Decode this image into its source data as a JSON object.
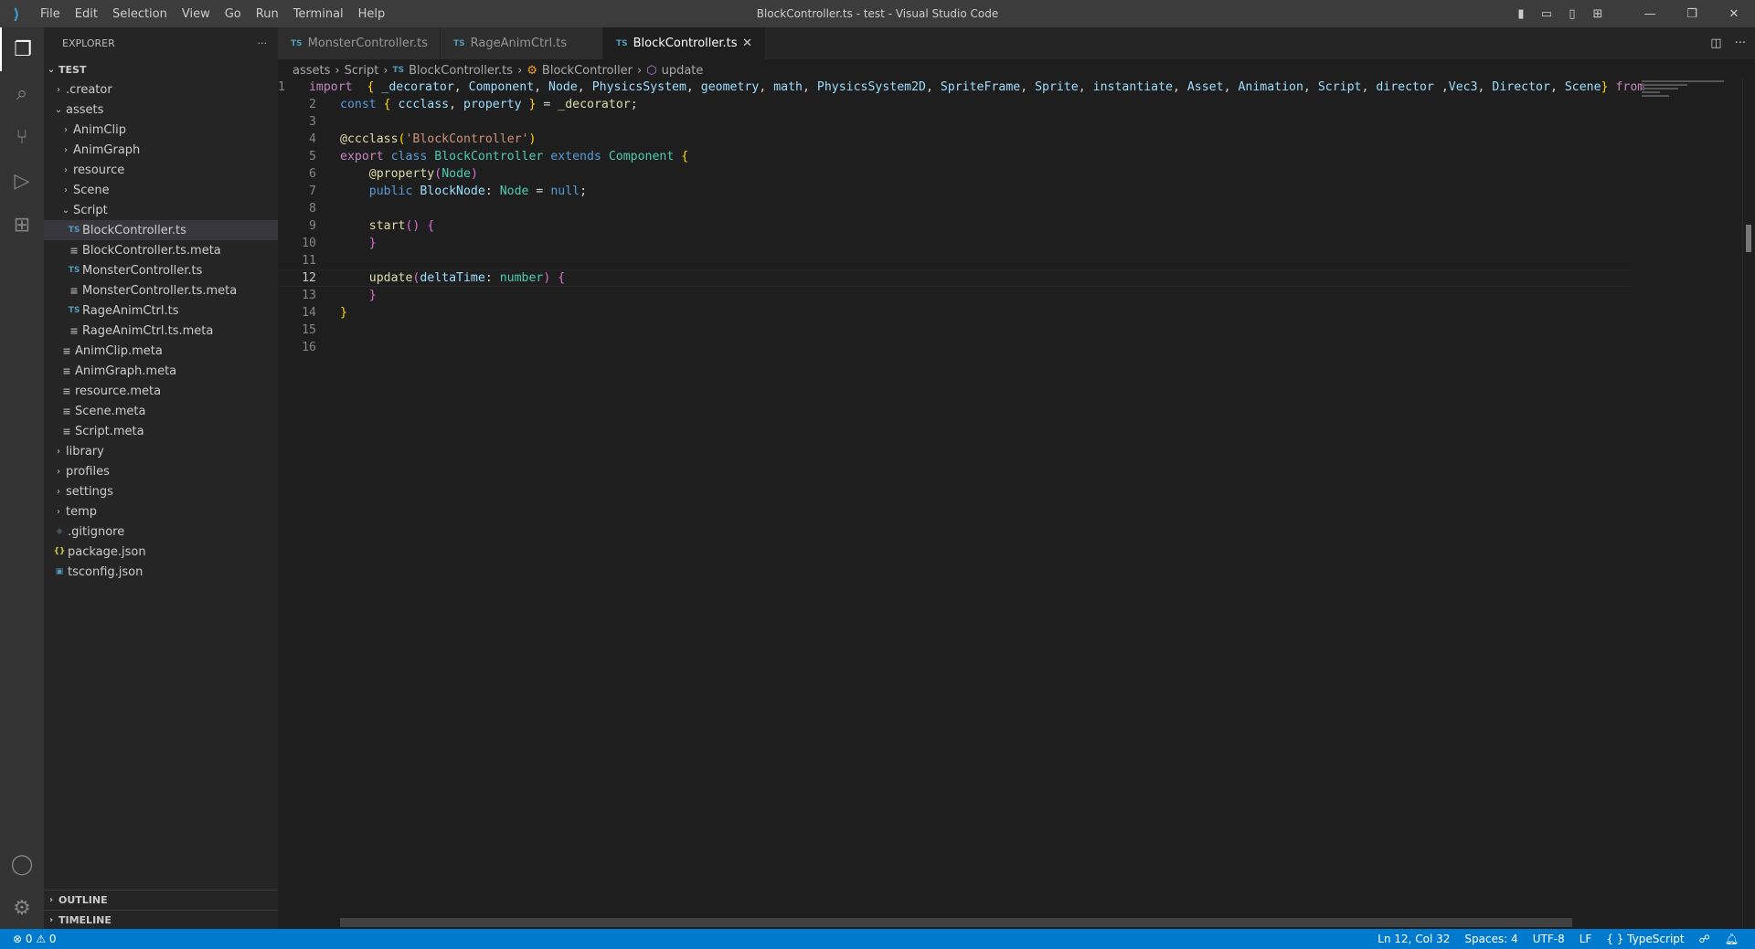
{
  "window": {
    "title": "BlockController.ts - test - Visual Studio Code"
  },
  "menu": [
    "File",
    "Edit",
    "Selection",
    "View",
    "Go",
    "Run",
    "Terminal",
    "Help"
  ],
  "sidebar": {
    "title": "EXPLORER",
    "more": "···",
    "root": "TEST",
    "tree": [
      {
        "label": ".creator",
        "depth": 1,
        "type": "folder",
        "open": false
      },
      {
        "label": "assets",
        "depth": 1,
        "type": "folder",
        "open": true
      },
      {
        "label": "AnimClip",
        "depth": 2,
        "type": "folder",
        "open": false
      },
      {
        "label": "AnimGraph",
        "depth": 2,
        "type": "folder",
        "open": false
      },
      {
        "label": "resource",
        "depth": 2,
        "type": "folder",
        "open": false
      },
      {
        "label": "Scene",
        "depth": 2,
        "type": "folder",
        "open": false
      },
      {
        "label": "Script",
        "depth": 2,
        "type": "folder",
        "open": true
      },
      {
        "label": "BlockController.ts",
        "depth": 3,
        "type": "ts",
        "selected": true
      },
      {
        "label": "BlockController.ts.meta",
        "depth": 3,
        "type": "meta"
      },
      {
        "label": "MonsterController.ts",
        "depth": 3,
        "type": "ts"
      },
      {
        "label": "MonsterController.ts.meta",
        "depth": 3,
        "type": "meta"
      },
      {
        "label": "RageAnimCtrl.ts",
        "depth": 3,
        "type": "ts"
      },
      {
        "label": "RageAnimCtrl.ts.meta",
        "depth": 3,
        "type": "meta"
      },
      {
        "label": "AnimClip.meta",
        "depth": 2,
        "type": "meta"
      },
      {
        "label": "AnimGraph.meta",
        "depth": 2,
        "type": "meta"
      },
      {
        "label": "resource.meta",
        "depth": 2,
        "type": "meta"
      },
      {
        "label": "Scene.meta",
        "depth": 2,
        "type": "meta"
      },
      {
        "label": "Script.meta",
        "depth": 2,
        "type": "meta"
      },
      {
        "label": "library",
        "depth": 1,
        "type": "folder",
        "open": false
      },
      {
        "label": "profiles",
        "depth": 1,
        "type": "folder",
        "open": false
      },
      {
        "label": "settings",
        "depth": 1,
        "type": "folder",
        "open": false
      },
      {
        "label": "temp",
        "depth": 1,
        "type": "folder",
        "open": false
      },
      {
        "label": ".gitignore",
        "depth": 1,
        "type": "git"
      },
      {
        "label": "package.json",
        "depth": 1,
        "type": "json"
      },
      {
        "label": "tsconfig.json",
        "depth": 1,
        "type": "tsconfig"
      }
    ],
    "outline": "OUTLINE",
    "timeline": "TIMELINE"
  },
  "tabs": [
    {
      "label": "MonsterController.ts",
      "icon": "TS"
    },
    {
      "label": "RageAnimCtrl.ts",
      "icon": "TS"
    },
    {
      "label": "BlockController.ts",
      "icon": "TS",
      "active": true
    }
  ],
  "breadcrumb": [
    "assets",
    "Script",
    "BlockController.ts",
    "BlockController",
    "update"
  ],
  "code": {
    "current_line": 12,
    "lines": [
      [
        [
          "kc",
          "import"
        ],
        [
          "",
          "  "
        ],
        [
          "b1",
          "{"
        ],
        [
          "v",
          " _decorator"
        ],
        [
          "",
          ", "
        ],
        [
          "v",
          "Component"
        ],
        [
          "",
          ", "
        ],
        [
          "v",
          "Node"
        ],
        [
          "",
          ", "
        ],
        [
          "v",
          "PhysicsSystem"
        ],
        [
          "",
          ", "
        ],
        [
          "v",
          "geometry"
        ],
        [
          "",
          ", "
        ],
        [
          "v",
          "math"
        ],
        [
          "",
          ", "
        ],
        [
          "v",
          "PhysicsSystem2D"
        ],
        [
          "",
          ", "
        ],
        [
          "v",
          "SpriteFrame"
        ],
        [
          "",
          ", "
        ],
        [
          "v",
          "Sprite"
        ],
        [
          "",
          ", "
        ],
        [
          "v",
          "instantiate"
        ],
        [
          "",
          ", "
        ],
        [
          "v",
          "Asset"
        ],
        [
          "",
          ", "
        ],
        [
          "v",
          "Animation"
        ],
        [
          "",
          ", "
        ],
        [
          "v",
          "Script"
        ],
        [
          "",
          ", "
        ],
        [
          "v",
          "director"
        ],
        [
          "",
          " ,"
        ],
        [
          "v",
          "Vec3"
        ],
        [
          "",
          ", "
        ],
        [
          "v",
          "Director"
        ],
        [
          "",
          ", "
        ],
        [
          "v",
          "Scene"
        ],
        [
          "b1",
          "}"
        ],
        [
          "kc",
          " from"
        ]
      ],
      [
        [
          "k",
          "const"
        ],
        [
          "",
          " "
        ],
        [
          "b1",
          "{"
        ],
        [
          "v",
          " ccclass"
        ],
        [
          "",
          ", "
        ],
        [
          "v",
          "property"
        ],
        [
          "",
          " "
        ],
        [
          "b1",
          "}"
        ],
        [
          "",
          " = "
        ],
        [
          "f",
          "_decorator"
        ],
        [
          "",
          ";"
        ]
      ],
      [],
      [
        [
          "f",
          "@ccclass"
        ],
        [
          "b1",
          "("
        ],
        [
          "s",
          "'BlockController'"
        ],
        [
          "b1",
          ")"
        ]
      ],
      [
        [
          "kc",
          "export"
        ],
        [
          "",
          " "
        ],
        [
          "k",
          "class"
        ],
        [
          "",
          " "
        ],
        [
          "t",
          "BlockController"
        ],
        [
          "",
          " "
        ],
        [
          "k",
          "extends"
        ],
        [
          "",
          " "
        ],
        [
          "t",
          "Component"
        ],
        [
          "",
          " "
        ],
        [
          "b1",
          "{"
        ]
      ],
      [
        [
          "",
          "    "
        ],
        [
          "f",
          "@property"
        ],
        [
          "b2",
          "("
        ],
        [
          "t",
          "Node"
        ],
        [
          "b2",
          ")"
        ]
      ],
      [
        [
          "",
          "    "
        ],
        [
          "k",
          "public"
        ],
        [
          "",
          " "
        ],
        [
          "v",
          "BlockNode"
        ],
        [
          "",
          ": "
        ],
        [
          "t",
          "Node"
        ],
        [
          "",
          " = "
        ],
        [
          "k",
          "null"
        ],
        [
          "",
          ";"
        ]
      ],
      [],
      [
        [
          "",
          "    "
        ],
        [
          "f",
          "start"
        ],
        [
          "b2",
          "()"
        ],
        [
          "",
          " "
        ],
        [
          "b2",
          "{"
        ]
      ],
      [
        [
          "",
          "    "
        ],
        [
          "b2",
          "}"
        ]
      ],
      [],
      [
        [
          "",
          "    "
        ],
        [
          "f",
          "update"
        ],
        [
          "b2",
          "("
        ],
        [
          "v",
          "deltaTime"
        ],
        [
          "",
          ": "
        ],
        [
          "t",
          "number"
        ],
        [
          "b2",
          ")"
        ],
        [
          "",
          " "
        ],
        [
          "b2",
          "{"
        ]
      ],
      [
        [
          "",
          "    "
        ],
        [
          "b2",
          "}"
        ]
      ],
      [
        [
          "b1",
          "}"
        ]
      ],
      [],
      []
    ]
  },
  "status": {
    "errors": "0",
    "warnings": "0",
    "position": "Ln 12, Col 32",
    "spaces": "Spaces: 4",
    "encoding": "UTF-8",
    "eol": "LF",
    "language": "TypeScript",
    "language_icon": "{ }"
  },
  "colors": {
    "statusbar": "#007acc",
    "accent": "#3b9de0"
  }
}
